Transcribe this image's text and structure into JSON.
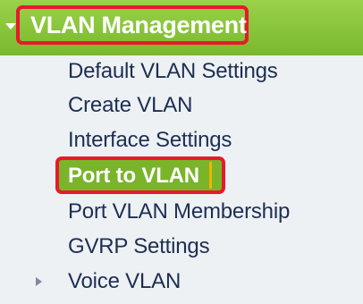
{
  "menu": {
    "section_title": "VLAN Management",
    "items": [
      {
        "label": "Default VLAN Settings"
      },
      {
        "label": "Create VLAN"
      },
      {
        "label": "Interface Settings"
      },
      {
        "label": "Port to VLAN",
        "selected": true
      },
      {
        "label": "Port VLAN Membership"
      },
      {
        "label": "GVRP Settings"
      },
      {
        "label": "Voice VLAN",
        "has_submenu": true
      }
    ]
  },
  "colors": {
    "header_green": "#8dc63f",
    "highlight_red": "#e8192c",
    "menu_background": "#eef1f4",
    "menu_text": "#1c2f52"
  },
  "icons": {
    "section_expander": "triangle-down-icon",
    "submenu_expander": "triangle-right-icon"
  }
}
